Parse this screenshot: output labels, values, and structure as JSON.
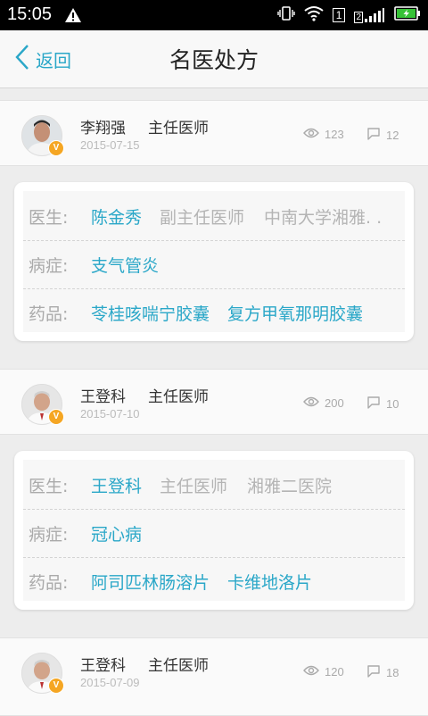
{
  "status_bar": {
    "time": "15:05",
    "sim1": "1",
    "sim2": "2"
  },
  "nav": {
    "back_label": "返回",
    "title": "名医处方"
  },
  "colors": {
    "accent": "#2aa7c8",
    "badge": "#f5a623"
  },
  "field_labels": {
    "doctor": "医生:",
    "disease": "病症:",
    "medicine": "药品:"
  },
  "posts": [
    {
      "name": "李翔强",
      "title": "主任医师",
      "date": "2015-07-15",
      "views": "123",
      "comments": "12",
      "card": {
        "doctor": "陈金秀",
        "doctor_title": "副主任医师",
        "hospital": "中南大学湘雅. .",
        "disease": "支气管炎",
        "medicines": [
          "苓桂咳喘宁胶囊",
          "复方甲氧那明胶囊"
        ]
      }
    },
    {
      "name": "王登科",
      "title": "主任医师",
      "date": "2015-07-10",
      "views": "200",
      "comments": "10",
      "card": {
        "doctor": "王登科",
        "doctor_title": "主任医师",
        "hospital": "湘雅二医院",
        "disease": "冠心病",
        "medicines": [
          "阿司匹林肠溶片",
          "卡维地洛片"
        ]
      }
    },
    {
      "name": "王登科",
      "title": "主任医师",
      "date": "2015-07-09",
      "views": "120",
      "comments": "18"
    }
  ]
}
